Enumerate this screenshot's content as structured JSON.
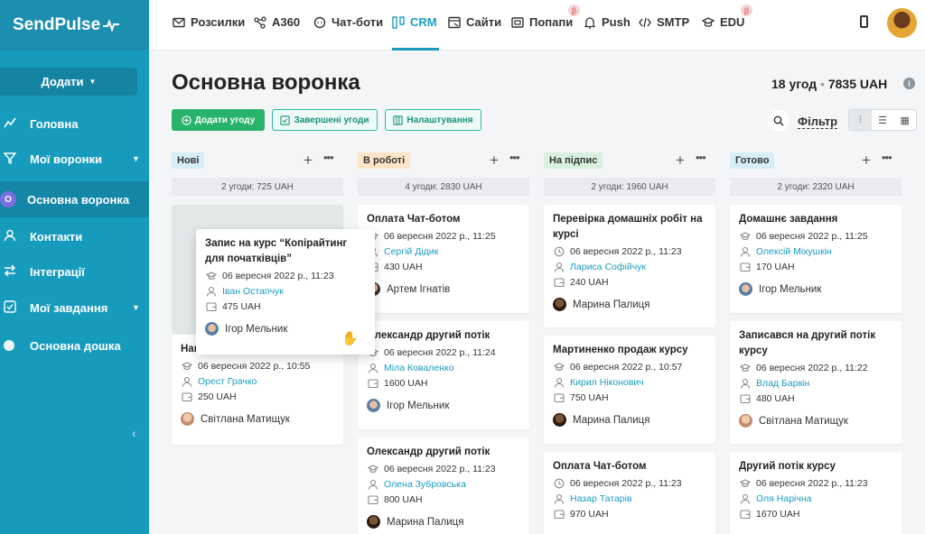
{
  "brand": {
    "name": "SendPulse"
  },
  "sidebar": {
    "add_label": "Додати",
    "items": [
      {
        "label": "Головна"
      },
      {
        "label": "Мої воронки"
      },
      {
        "label": "Основна воронка",
        "badge": "О"
      },
      {
        "label": "Контакти"
      },
      {
        "label": "Інтеграції"
      },
      {
        "label": "Мої завдання"
      },
      {
        "label": "Основна дошка"
      }
    ]
  },
  "topnav": {
    "items": [
      {
        "label": "Розсилки"
      },
      {
        "label": "A360"
      },
      {
        "label": "Чат-боти"
      },
      {
        "label": "CRM"
      },
      {
        "label": "Сайти"
      },
      {
        "label": "Попапи"
      },
      {
        "label": "Push"
      },
      {
        "label": "SMTP"
      },
      {
        "label": "EDU"
      }
    ],
    "beta": "β"
  },
  "header": {
    "title": "Основна воронка",
    "count": "18 угод",
    "sep": "•",
    "total": "7835 UAH",
    "add_deal": "Додати угоду",
    "closed_deals": "Завершені угоди",
    "settings": "Налаштування",
    "filter": "Фільтр"
  },
  "columns": [
    {
      "name": "Нові",
      "color": "#d6eef8",
      "summary": "2 угоди: 725 UAH",
      "cards": [
        {
          "title": "Нап",
          "date": "06 вересня 2022 р., 10:55",
          "contact": "Орест Грачко",
          "amount": "250 UAH",
          "person": "Світлана Матищук"
        }
      ]
    },
    {
      "name": "В роботі",
      "color": "#fde5c6",
      "summary": "4 угоди: 2830 UAH",
      "cards": [
        {
          "title": "Оплата Чат-ботом",
          "date": "06 вересня 2022 р., 11:25",
          "contact": "Сергій Дідик",
          "amount": "430 UAH",
          "person": "Артем Ігнатів"
        },
        {
          "title": "Олександр другий потік",
          "date": "06 вересня 2022 р., 11:24",
          "contact": "Міла Коваленко",
          "amount": "1600 UAH",
          "person": "Ігор Мельник"
        },
        {
          "title": "Олександр другий потік",
          "date": "06 вересня 2022 р., 11:23",
          "contact": "Олена Зубровська",
          "amount": "800 UAH",
          "person": "Марина Палиця"
        }
      ]
    },
    {
      "name": "На підпис",
      "color": "#d8f1df",
      "summary": "2 угоди: 1960 UAH",
      "cards": [
        {
          "title": "Перевірка домашніх робіт на курсі",
          "date": "06 вересня 2022 р., 11:23",
          "contact": "Лариса Софійчук",
          "amount": "240 UAH",
          "person": "Марина Палиця"
        },
        {
          "title": "Мартиненко продаж курсу",
          "date": "06 вересня 2022 р., 10:57",
          "contact": "Кирил Ніконович",
          "amount": "750 UAH",
          "person": "Марина Палиця"
        },
        {
          "title": "Оплата Чат-ботом",
          "date": "06 вересня 2022 р., 11:23",
          "contact": "Назар Татарів",
          "amount": "970 UAH",
          "person": ""
        }
      ]
    },
    {
      "name": "Готово",
      "color": "#d6eef8",
      "summary": "2 угоди: 2320 UAH",
      "cards": [
        {
          "title": "Домашнє завдання",
          "date": "06 вересня 2022 р., 11:25",
          "contact": "Олексій Міхушкін",
          "amount": "170 UAH",
          "person": "Ігор Мельник"
        },
        {
          "title": "Записався на другий потік курсу",
          "date": "06 вересня 2022 р., 11:22",
          "contact": "Влад Баркін",
          "amount": "480 UAH",
          "person": "Світлана Матищук"
        },
        {
          "title": "Другий потік курсу",
          "date": "06 вересня 2022 р., 11:23",
          "contact": "Оля Нарічна",
          "amount": "1670 UAH",
          "person": ""
        }
      ]
    }
  ],
  "dragging_card": {
    "title": "Запис на курс “Копірайтинг для початківців”",
    "date": "06 вересня 2022 р., 11:23",
    "contact": "Іван Остапчук",
    "amount": "475 UAH",
    "person": "Ігор Мельник"
  }
}
